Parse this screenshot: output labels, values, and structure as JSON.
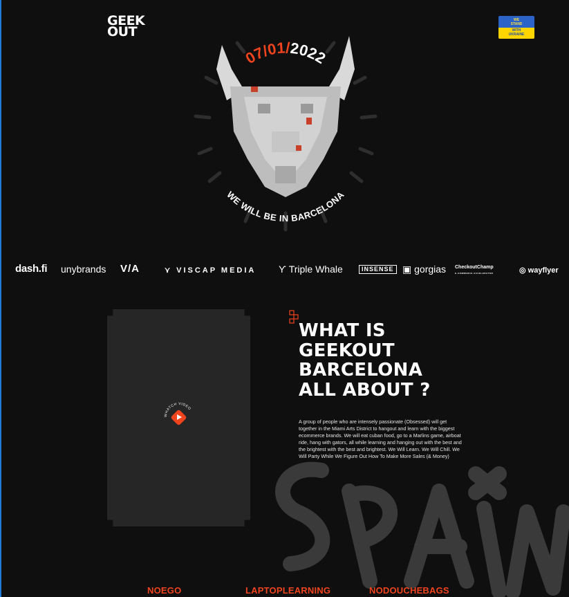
{
  "header": {
    "logo_line1": "GEEK",
    "logo_line2": "OUT",
    "ukraine_badge": {
      "line1": "WE",
      "line2": "STAND",
      "line3": "WITH",
      "line4": "UKRAINE"
    }
  },
  "hero": {
    "date_highlight": "07/01/",
    "date_rest": "2022",
    "tagline": "WE WILL BE IN BARCELONA",
    "accent_color": "#f0441e"
  },
  "partner_logos": [
    {
      "name": "dash.fi"
    },
    {
      "name": "unybrands"
    },
    {
      "name": "V/A"
    },
    {
      "name": "VISCAP MEDIA"
    },
    {
      "name": "Triple Whale"
    },
    {
      "name": "INSENSE"
    },
    {
      "name": "gorgias"
    },
    {
      "name": "CheckoutChamp",
      "sub": "E-COMMERCE ACCELERATOR"
    },
    {
      "name": "wayflyer"
    }
  ],
  "video": {
    "label": "WHATCH VIDEO"
  },
  "about": {
    "title_lines": [
      "WHAT IS",
      "GEEKOUT",
      "BARCELONA",
      "ALL ABOUT ?"
    ],
    "description": "A group of people who are intensely passionate (Obsessed) will get together in the Miami Arts District to hangout and learn with the biggest ecommerce brands. We will eat cuban food, go to a Marlins game, airboat ride, hang with gators, all while learning and hanging out with the best and the brightest with the best and brightest. We Will Learn. We Will Chill. We Will Party While We Figure Out How To Make More Sales (& Money)"
  },
  "graffiti_text": "SPAIN",
  "bottom_nav": [
    "NOEGO",
    "LAPTOPLEARNING",
    "NODOUCHEBAGS"
  ]
}
